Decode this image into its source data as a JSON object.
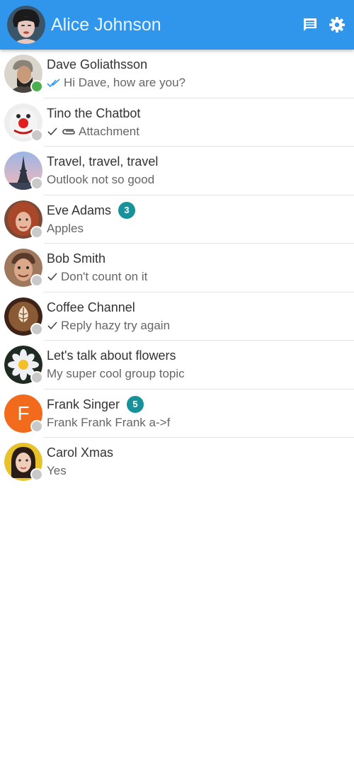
{
  "header": {
    "title": "Alice Johnson",
    "background": "#2f96ec",
    "icons": [
      "new-chat-icon",
      "gear-icon"
    ]
  },
  "chats": [
    {
      "name": "Dave Goliathsson",
      "message": "Hi Dave, how are you?",
      "status": "read",
      "presence": "online",
      "badge": ""
    },
    {
      "name": "Tino the Chatbot",
      "message": "Attachment",
      "status": "sent",
      "attachment": true,
      "presence": "offline",
      "badge": ""
    },
    {
      "name": "Travel, travel, travel",
      "message": "Outlook not so good",
      "status": "",
      "presence": "offline",
      "badge": ""
    },
    {
      "name": "Eve Adams",
      "message": "Apples",
      "status": "",
      "presence": "offline",
      "badge": "3"
    },
    {
      "name": "Bob Smith",
      "message": "Don't count on it",
      "status": "sent",
      "presence": "offline",
      "badge": ""
    },
    {
      "name": "Coffee Channel",
      "message": "Reply hazy try again",
      "status": "sent",
      "presence": "offline",
      "badge": ""
    },
    {
      "name": "Let's talk about flowers",
      "message": "My super cool group topic",
      "status": "",
      "presence": "offline",
      "badge": ""
    },
    {
      "name": "Frank Singer",
      "message": "Frank Frank Frank a->f",
      "status": "",
      "presence": "offline",
      "badge": "5",
      "initial": "F"
    },
    {
      "name": "Carol Xmas",
      "message": "Yes",
      "status": "",
      "presence": "offline",
      "badge": ""
    }
  ],
  "colors": {
    "accent": "#2f96ec",
    "badge": "#17929b",
    "online": "#4caf50",
    "offline": "#c9c9c9",
    "read_check": "#2f96ec",
    "letter_avatar": "#f26b1d"
  }
}
